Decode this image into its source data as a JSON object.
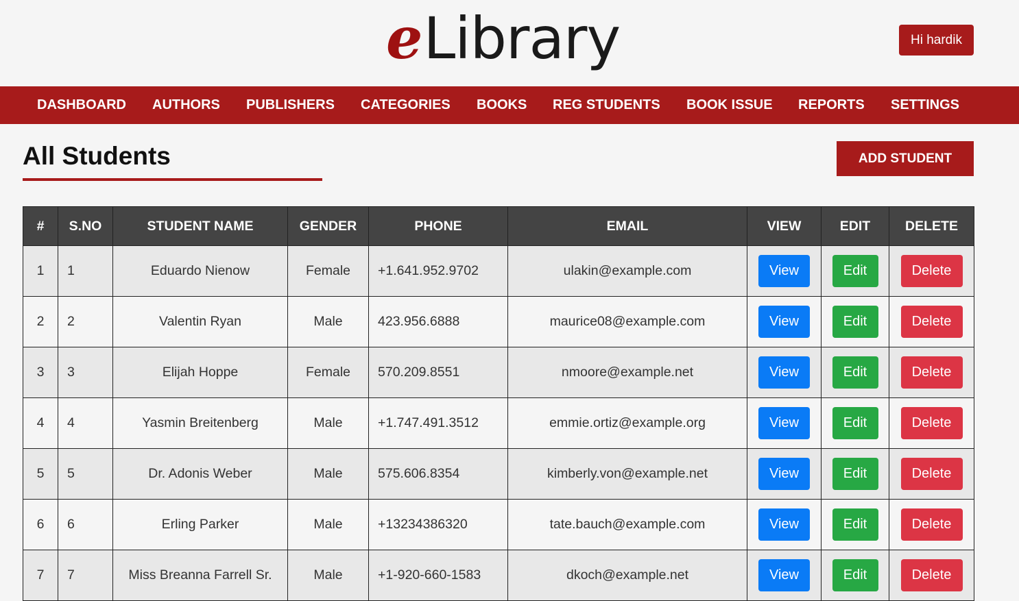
{
  "header": {
    "logo_e": "e",
    "logo_rest": "Library",
    "greeting": "Hi hardik"
  },
  "nav": {
    "items": [
      {
        "label": "DASHBOARD"
      },
      {
        "label": "AUTHORS"
      },
      {
        "label": "PUBLISHERS"
      },
      {
        "label": "CATEGORIES"
      },
      {
        "label": "BOOKS"
      },
      {
        "label": "REG STUDENTS"
      },
      {
        "label": "BOOK ISSUE"
      },
      {
        "label": "REPORTS"
      },
      {
        "label": "SETTINGS"
      }
    ]
  },
  "page": {
    "title": "All Students",
    "add_button": "ADD STUDENT"
  },
  "table": {
    "headers": [
      "#",
      "S.NO",
      "STUDENT NAME",
      "GENDER",
      "PHONE",
      "EMAIL",
      "VIEW",
      "EDIT",
      "DELETE"
    ],
    "rows": [
      {
        "idx": "1",
        "sno": "1",
        "name": "Eduardo Nienow",
        "gender": "Female",
        "phone": "+1.641.952.9702",
        "email": "ulakin@example.com",
        "view": "View",
        "edit": "Edit",
        "delete": "Delete"
      },
      {
        "idx": "2",
        "sno": "2",
        "name": "Valentin Ryan",
        "gender": "Male",
        "phone": "423.956.6888",
        "email": "maurice08@example.com",
        "view": "View",
        "edit": "Edit",
        "delete": "Delete"
      },
      {
        "idx": "3",
        "sno": "3",
        "name": "Elijah Hoppe",
        "gender": "Female",
        "phone": "570.209.8551",
        "email": "nmoore@example.net",
        "view": "View",
        "edit": "Edit",
        "delete": "Delete"
      },
      {
        "idx": "4",
        "sno": "4",
        "name": "Yasmin Breitenberg",
        "gender": "Male",
        "phone": "+1.747.491.3512",
        "email": "emmie.ortiz@example.org",
        "view": "View",
        "edit": "Edit",
        "delete": "Delete"
      },
      {
        "idx": "5",
        "sno": "5",
        "name": "Dr. Adonis Weber",
        "gender": "Male",
        "phone": "575.606.8354",
        "email": "kimberly.von@example.net",
        "view": "View",
        "edit": "Edit",
        "delete": "Delete"
      },
      {
        "idx": "6",
        "sno": "6",
        "name": "Erling Parker",
        "gender": "Male",
        "phone": "+13234386320",
        "email": "tate.bauch@example.com",
        "view": "View",
        "edit": "Edit",
        "delete": "Delete"
      },
      {
        "idx": "7",
        "sno": "7",
        "name": "Miss Breanna Farrell Sr.",
        "gender": "Male",
        "phone": "+1-920-660-1583",
        "email": "dkoch@example.net",
        "view": "View",
        "edit": "Edit",
        "delete": "Delete"
      }
    ]
  },
  "colors": {
    "brand": "#a71b1b",
    "table_header": "#444444",
    "view": "#0a7bf6",
    "edit": "#27a844",
    "delete": "#dc3545"
  }
}
